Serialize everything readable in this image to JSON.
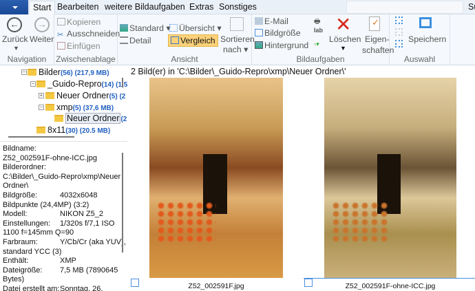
{
  "tabs": [
    "Start",
    "Bearbeiten",
    "weitere Bildaufgaben",
    "Extras",
    "Sonstiges"
  ],
  "search_label": "Suchen",
  "ribbon": {
    "navigation": {
      "label": "Navigation",
      "back": "Zurück",
      "forward": "Weiter"
    },
    "clipboard": {
      "label": "Zwischenablage",
      "copy": "Kopieren",
      "cut": "Ausschneiden",
      "paste": "Einfügen"
    },
    "view": {
      "label": "Ansicht",
      "standard": "Standard",
      "detail": "Detail",
      "overview": "Übersicht",
      "compare": "Vergleich",
      "sort1": "Sortieren",
      "sort2": "nach"
    },
    "image_tasks": {
      "label": "Bildaufgaben",
      "email": "E-Mail",
      "size": "Bildgröße",
      "background": "Hintergrund",
      "delete": "Löschen",
      "props1": "Eigen-",
      "props2": "schaften"
    },
    "selection": {
      "label": "Auswahl",
      "save": "Speichern"
    }
  },
  "tree": [
    {
      "name": "Bilder",
      "count": "(56) (217,9 MB)"
    },
    {
      "name": "_Guido-Repro",
      "count": "(14) (1,5"
    },
    {
      "name": "Neuer Ordner",
      "count": "(5) (2"
    },
    {
      "name": "xmp",
      "count": "(5) (37,6 MB)"
    },
    {
      "name": "Neuer Ordner",
      "count": "(2"
    },
    {
      "name": "8x11",
      "count": "(30) (20.5 MB)"
    }
  ],
  "info": [
    [
      "Bildname:",
      ""
    ],
    [
      "Z52_002591F-ohne-ICC.jpg",
      ""
    ],
    [
      "Bilderordner:",
      ""
    ],
    [
      "C:\\Bilder\\_Guido-Repro\\xmp\\Neuer",
      ""
    ],
    [
      "Ordner\\",
      ""
    ],
    [
      "Bildgröße:",
      "4032x6048"
    ],
    [
      "Bildpunkte (24,4MP) (3:2)",
      ""
    ],
    [
      "Modell:",
      "NIKON Z5_2"
    ],
    [
      "Einstellungen:",
      "1/320s f/7,1 ISO"
    ],
    [
      "1100 f=145mm Q=90",
      ""
    ],
    [
      "Farbraum:",
      "Y/Cb/Cr (aka YUV),"
    ],
    [
      "standard YCC (3)",
      ""
    ],
    [
      "Enthält:",
      "XMP"
    ],
    [
      "Dateigröße:",
      "7,5 MB (7890645"
    ],
    [
      "Bytes)",
      ""
    ],
    [
      "Datei erstellt am:",
      "Sonntag, 26,"
    ]
  ],
  "main": {
    "caption": "2 Bild(er) in 'C:\\Bilder\\_Guido-Repro\\xmp\\Neuer Ordner\\'",
    "files": [
      "Z52_002591F.jpg",
      "Z52_002591F-ohne-ICC.jpg"
    ]
  }
}
